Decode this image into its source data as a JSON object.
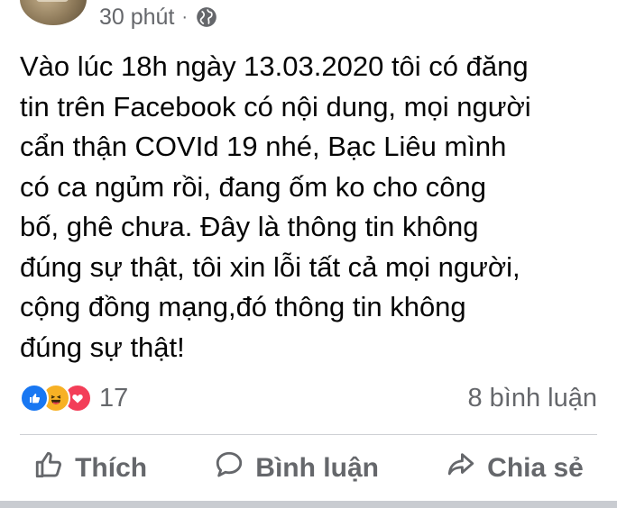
{
  "post": {
    "time": "30 phút",
    "separator": "·",
    "privacy_icon": "globe-icon",
    "text": "Vào lúc 18h ngày 13.03.2020 tôi có đăng\ntin trên Facebook có nội dung, mọi người\ncẩn thận  COVId 19 nhé, Bạc Liêu mình\ncó ca ngủm rồi, đang ốm ko cho công\nbố, ghê chưa. Đây là thông tin không\nđúng sự thật, tôi xin lỗi tất cả mọi người,\ncộng đồng mạng,đó thông tin không\nđúng sự thật!"
  },
  "stats": {
    "reactions": [
      "like-icon",
      "haha-icon",
      "love-icon"
    ],
    "reaction_count": "17",
    "comment_count": "8 bình luận"
  },
  "actions": {
    "like_label": "Thích",
    "comment_label": "Bình luận",
    "share_label": "Chia sẻ"
  },
  "colors": {
    "like": "#1877f2",
    "haha": "#f7b125",
    "love": "#f33e58",
    "secondary_text": "#65676b"
  }
}
